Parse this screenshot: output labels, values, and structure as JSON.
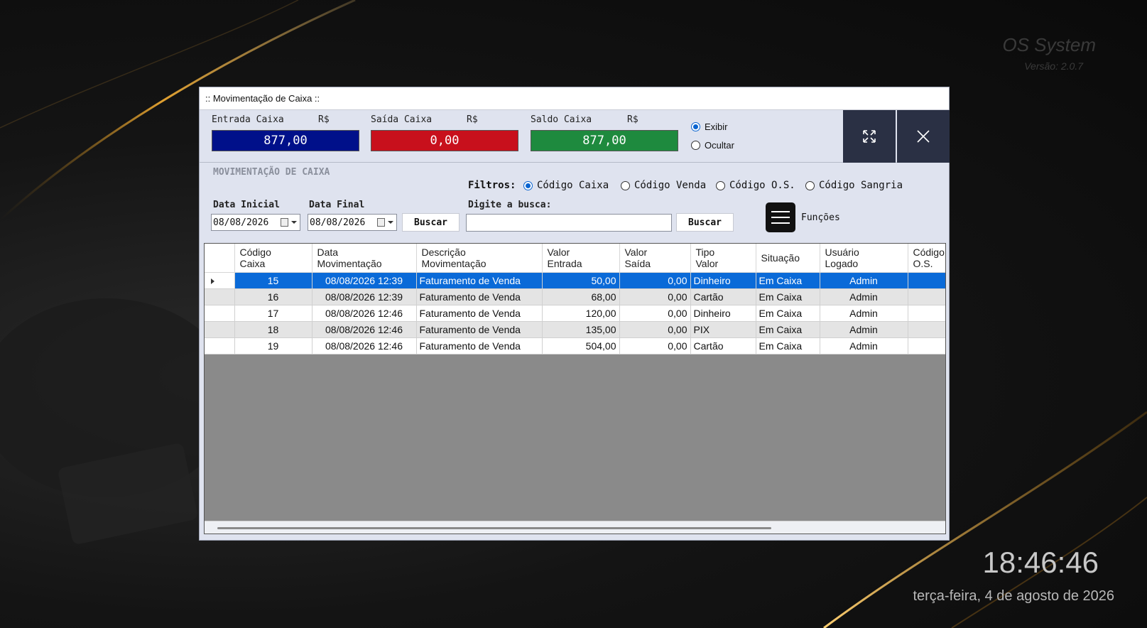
{
  "desktop": {
    "brand_name": "OS System",
    "brand_version": "Versão: 2.0.7",
    "clock": "18:46:46",
    "date": "terça-feira, 4 de agosto de 2026"
  },
  "window": {
    "title": "::  Movimentação de Caixa  ::",
    "summary": {
      "entrada": {
        "label": "Entrada Caixa",
        "currency": "R$",
        "value": "877,00",
        "color": "#00108a"
      },
      "saida": {
        "label": "Saída Caixa",
        "currency": "R$",
        "value": "0,00",
        "color": "#c8101c"
      },
      "saldo": {
        "label": "Saldo Caixa",
        "currency": "R$",
        "value": "877,00",
        "color": "#1e8a3e"
      },
      "show_options": [
        {
          "label": "Exibir",
          "selected": true
        },
        {
          "label": "Ocultar",
          "selected": false
        }
      ]
    },
    "section_title": "MOVIMENTAÇÃO DE CAIXA",
    "filters": {
      "label": "Filtros:",
      "options": [
        {
          "label": "Código Caixa",
          "selected": true
        },
        {
          "label": "Código Venda",
          "selected": false
        },
        {
          "label": "Código O.S.",
          "selected": false
        },
        {
          "label": "Código Sangria",
          "selected": false
        }
      ]
    },
    "date_start": {
      "label": "Data Inicial",
      "value": "08/08/2026"
    },
    "date_end": {
      "label": "Data Final",
      "value": "08/08/2026"
    },
    "buscar_dates_label": "Buscar",
    "search": {
      "label": "Digite a busca:",
      "value": "",
      "button_label": "Buscar"
    },
    "funcoes_label": "Funções",
    "table": {
      "columns": [
        [
          "Código",
          "Caixa"
        ],
        [
          "Data",
          "Movimentação"
        ],
        [
          "Descrição",
          "Movimentação"
        ],
        [
          "Valor",
          "Entrada"
        ],
        [
          "Valor",
          "Saída"
        ],
        [
          "Tipo",
          "Valor"
        ],
        [
          "Situação",
          ""
        ],
        [
          "Usuário",
          "Logado"
        ],
        [
          "Código",
          "O.S."
        ]
      ],
      "rows": [
        [
          "15",
          "08/08/2026 12:39",
          "Faturamento de Venda",
          "50,00",
          "0,00",
          "Dinheiro",
          "Em Caixa",
          "Admin",
          ""
        ],
        [
          "16",
          "08/08/2026 12:39",
          "Faturamento de Venda",
          "68,00",
          "0,00",
          "Cartão",
          "Em Caixa",
          "Admin",
          ""
        ],
        [
          "17",
          "08/08/2026 12:46",
          "Faturamento de Venda",
          "120,00",
          "0,00",
          "Dinheiro",
          "Em Caixa",
          "Admin",
          ""
        ],
        [
          "18",
          "08/08/2026 12:46",
          "Faturamento de Venda",
          "135,00",
          "0,00",
          "PIX",
          "Em Caixa",
          "Admin",
          ""
        ],
        [
          "19",
          "08/08/2026 12:46",
          "Faturamento de Venda",
          "504,00",
          "0,00",
          "Cartão",
          "Em Caixa",
          "Admin",
          ""
        ]
      ],
      "selected_row": 0
    }
  }
}
